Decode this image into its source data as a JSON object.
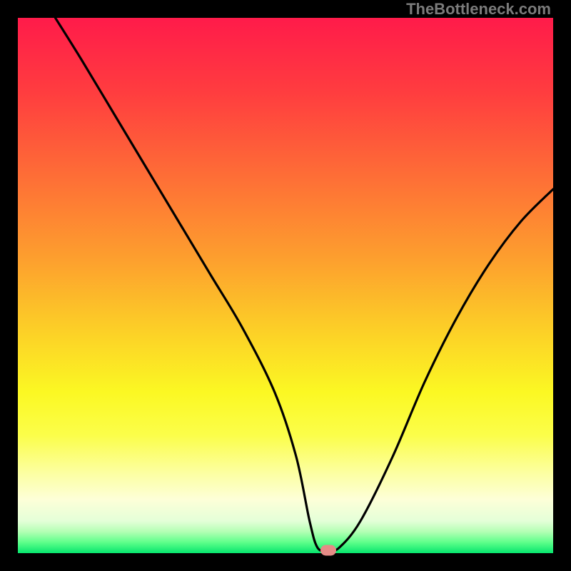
{
  "watermark": "TheBottleneck.com",
  "chart_data": {
    "type": "line",
    "title": "",
    "xlabel": "",
    "ylabel": "",
    "xlim": [
      0,
      100
    ],
    "ylim": [
      0,
      100
    ],
    "grid": false,
    "legend": false,
    "gradient_stops": [
      {
        "pct": 0,
        "color": "#ff1b4a"
      },
      {
        "pct": 14,
        "color": "#ff3d3f"
      },
      {
        "pct": 30,
        "color": "#fe6f36"
      },
      {
        "pct": 45,
        "color": "#fd9f2e"
      },
      {
        "pct": 58,
        "color": "#fcce27"
      },
      {
        "pct": 70,
        "color": "#fbf823"
      },
      {
        "pct": 78,
        "color": "#fbfe4a"
      },
      {
        "pct": 85,
        "color": "#fcffa1"
      },
      {
        "pct": 90,
        "color": "#fdffd8"
      },
      {
        "pct": 94,
        "color": "#e4ffd8"
      },
      {
        "pct": 96,
        "color": "#b3ffb4"
      },
      {
        "pct": 98,
        "color": "#5dff8a"
      },
      {
        "pct": 100,
        "color": "#06e56d"
      }
    ],
    "series": [
      {
        "name": "bottleneck-curve",
        "color": "#000000",
        "x": [
          7,
          12,
          18,
          24,
          30,
          36,
          42,
          48,
          52,
          54.5,
          56,
          58,
          60,
          64,
          70,
          76,
          82,
          88,
          94,
          100
        ],
        "y": [
          100,
          92,
          82,
          72,
          62,
          52,
          42,
          30,
          18,
          6,
          1,
          0.5,
          1,
          6,
          18,
          32,
          44,
          54,
          62,
          68
        ]
      }
    ],
    "marker": {
      "x": 58,
      "y": 0.5,
      "color": "#e58b86"
    }
  }
}
